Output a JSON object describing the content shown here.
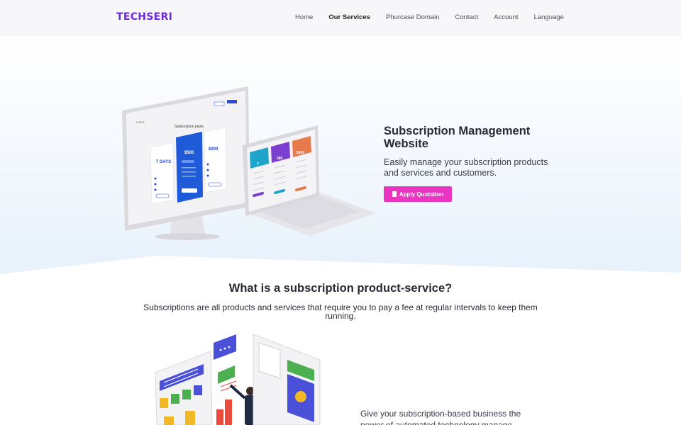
{
  "nav": {
    "logo": "TECHSERI",
    "items": [
      {
        "label": "Home",
        "active": false
      },
      {
        "label": "Our Services",
        "active": true
      },
      {
        "label": "Phurcase Domain",
        "active": false
      },
      {
        "label": "Contact",
        "active": false
      },
      {
        "label": "Account",
        "active": false
      },
      {
        "label": "Language",
        "active": false
      }
    ]
  },
  "hero": {
    "title": "Subscription Management Website",
    "subtitle": "Easily manage your subscription products and services and customers.",
    "cta_label": "Apply Quotation",
    "cta_color": "#e935c1",
    "mockup": {
      "screen_logo": "LOGO",
      "screen_heading": "Subscription plans",
      "plans": [
        "7 DAYS",
        "$500",
        "$999"
      ],
      "laptop_prices": [
        "7",
        "380",
        "$599"
      ]
    }
  },
  "section": {
    "title": "What is a subscription product-service?",
    "description": "Subscriptions are all products and services that require you to pay a fee at regular intervals to keep them running.",
    "body_text": "Give your subscription-based business the power of automated technology manage"
  },
  "colors": {
    "brand": "#6d28d9",
    "accent": "#e935c1",
    "hero_bg": "#eaf3fc"
  }
}
